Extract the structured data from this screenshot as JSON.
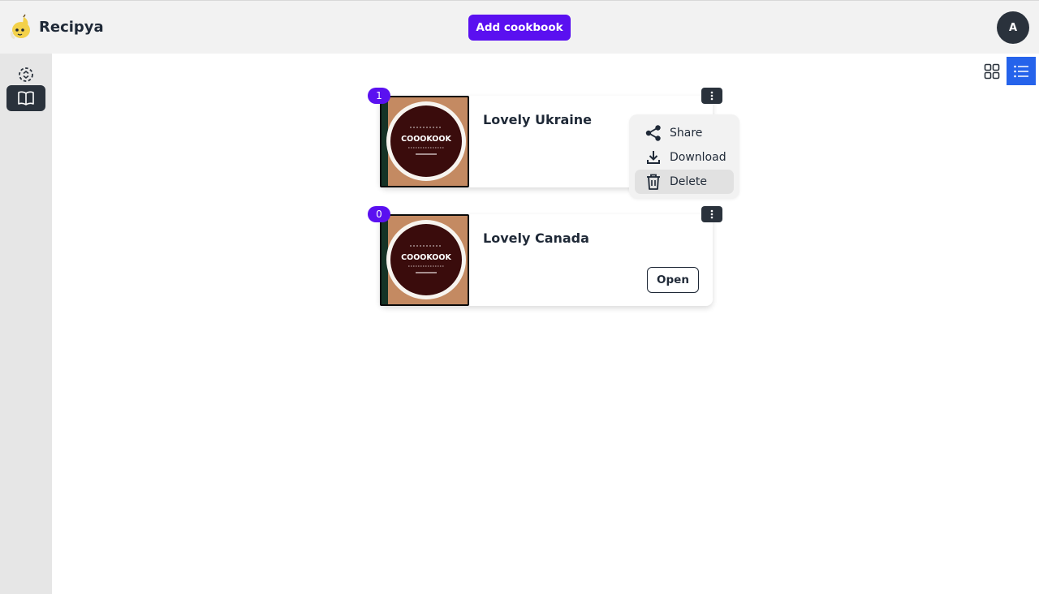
{
  "app": {
    "name": "Recipya",
    "add_button_label": "Add cookbook",
    "avatar_initial": "A",
    "brand_color": "#5a10f0"
  },
  "sidebar": {
    "items": [
      {
        "icon": "scan-dashed-icon",
        "active": false
      },
      {
        "icon": "open-book-icon",
        "active": true
      }
    ]
  },
  "view_toggle": {
    "options": [
      {
        "icon": "grid-view-icon",
        "active": false
      },
      {
        "icon": "list-view-icon",
        "active": true
      }
    ]
  },
  "cookbooks": [
    {
      "title": "Lovely Ukraine",
      "count": "1",
      "cover_text": "COOOKOOK",
      "menu_open": true
    },
    {
      "title": "Lovely Canada",
      "count": "0",
      "cover_text": "COOOKOOK",
      "open_label": "Open",
      "menu_open": false
    }
  ],
  "context_menu": {
    "items": [
      {
        "label": "Share",
        "icon": "share-icon"
      },
      {
        "label": "Download",
        "icon": "download-icon"
      },
      {
        "label": "Delete",
        "icon": "trash-icon",
        "hovered": true
      }
    ]
  }
}
